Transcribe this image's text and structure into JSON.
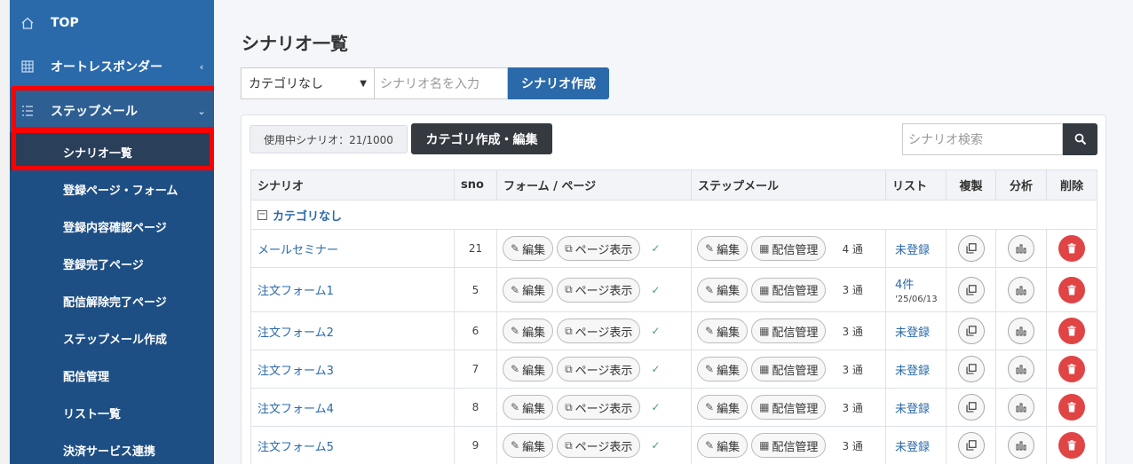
{
  "sidebar": {
    "items": [
      {
        "label": "TOP",
        "icon": "home-icon",
        "chevron": ""
      },
      {
        "label": "オートレスポンダー",
        "icon": "grid-icon",
        "chevron": "‹"
      },
      {
        "label": "ステップメール",
        "icon": "list-icon",
        "chevron": "⌄"
      }
    ],
    "sub_items": [
      {
        "label": "シナリオ一覧"
      },
      {
        "label": "登録ページ・フォーム"
      },
      {
        "label": "登録内容確認ページ"
      },
      {
        "label": "登録完了ページ"
      },
      {
        "label": "配信解除完了ページ"
      },
      {
        "label": "ステップメール作成"
      },
      {
        "label": "配信管理"
      },
      {
        "label": "リスト一覧"
      },
      {
        "label": "決済サービス連携"
      }
    ]
  },
  "main": {
    "title": "シナリオ一覧",
    "category_select": {
      "value": "カテゴリなし"
    },
    "name_input": {
      "placeholder": "シナリオ名を入力"
    },
    "create_button": "シナリオ作成",
    "usage_badge": "使用中シナリオ：21/1000",
    "category_button": "カテゴリ作成・編集",
    "search": {
      "placeholder": "シナリオ検索"
    }
  },
  "table": {
    "headers": [
      "シナリオ",
      "sno",
      "フォーム / ページ",
      "ステップメール",
      "リスト",
      "複製",
      "分析",
      "削除"
    ],
    "group_label": "カテゴリなし",
    "group_toggle": "−",
    "edit_label": "編集",
    "page_view_label": "ページ表示",
    "delivery_label": "配信管理",
    "rows": [
      {
        "name": "メールセミナー",
        "sno": "21",
        "count": "4 通",
        "list": "未登録",
        "date": ""
      },
      {
        "name": "注文フォーム1",
        "sno": "5",
        "count": "3 通",
        "list": "4件",
        "date": "'25/06/13"
      },
      {
        "name": "注文フォーム2",
        "sno": "6",
        "count": "3 通",
        "list": "未登録",
        "date": ""
      },
      {
        "name": "注文フォーム3",
        "sno": "7",
        "count": "3 通",
        "list": "未登録",
        "date": ""
      },
      {
        "name": "注文フォーム4",
        "sno": "8",
        "count": "3 通",
        "list": "未登録",
        "date": ""
      },
      {
        "name": "注文フォーム5",
        "sno": "9",
        "count": "3 通",
        "list": "未登録",
        "date": ""
      }
    ]
  },
  "colors": {
    "sidebar": "#1e4f84",
    "accent": "#2b6aaa",
    "highlight": "#ff0000",
    "danger": "#e04444",
    "dark_button": "#343a40"
  }
}
